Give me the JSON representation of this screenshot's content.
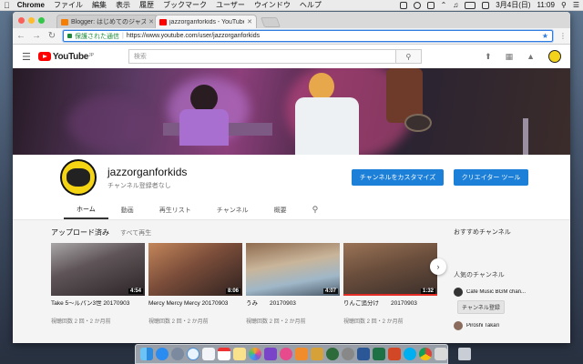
{
  "menubar": {
    "app": "Chrome",
    "items": [
      "ファイル",
      "編集",
      "表示",
      "履歴",
      "ブックマーク",
      "ユーザー",
      "ウインドウ",
      "ヘルプ"
    ],
    "date": "3月4日(日)",
    "time": "11:09"
  },
  "browser": {
    "tabs": [
      {
        "title": "Blogger: はじめてのジャズオルガ",
        "active": false
      },
      {
        "title": "jazzorganforkids - YouTube",
        "active": true
      }
    ],
    "secure_label": "保護された通信",
    "url": "https://www.youtube.com/user/jazzorganforkids"
  },
  "youtube": {
    "logo": "YouTube",
    "logo_sup": "JP",
    "search_placeholder": "検索",
    "channel_name": "jazzorganforkids",
    "channel_subs": "チャンネル登録者なし",
    "customize_label": "チャンネルをカスタマイズ",
    "creator_label": "クリエイター ツール",
    "tabs": [
      "ホーム",
      "動画",
      "再生リスト",
      "チャンネル",
      "概要"
    ],
    "section_title": "アップロード済み",
    "play_all": "すべて再生",
    "videos": [
      {
        "title": "Take 5～ルパン3世 20170903",
        "meta": "視聴回数 2 回・2 か月前",
        "duration": "4:54",
        "progress": 0
      },
      {
        "title": "Mercy Mercy Mercy 20170903",
        "meta": "視聴回数 2 回・2 か月前",
        "duration": "8:06",
        "progress": 0
      },
      {
        "title": "うみ　　20170903",
        "meta": "視聴回数 2 回・2 か月前",
        "duration": "4:07",
        "progress": 0
      },
      {
        "title": "りんご追分け　　20170903",
        "meta": "視聴回数 2 回・2 か月前",
        "duration": "1:32",
        "progress": 1
      }
    ],
    "sidebar": {
      "recommended": "おすすめチャンネル",
      "popular": "人気のチャンネル",
      "rec_channel": "Cafe Music BGM chan...",
      "subscribe": "チャンネル登録",
      "rec_channel2": "Piroshi Takari"
    }
  },
  "colors": {
    "accent_blue": "#1c7fd8",
    "yt_red": "#ff0000",
    "secure_green": "#1c8a3a"
  }
}
